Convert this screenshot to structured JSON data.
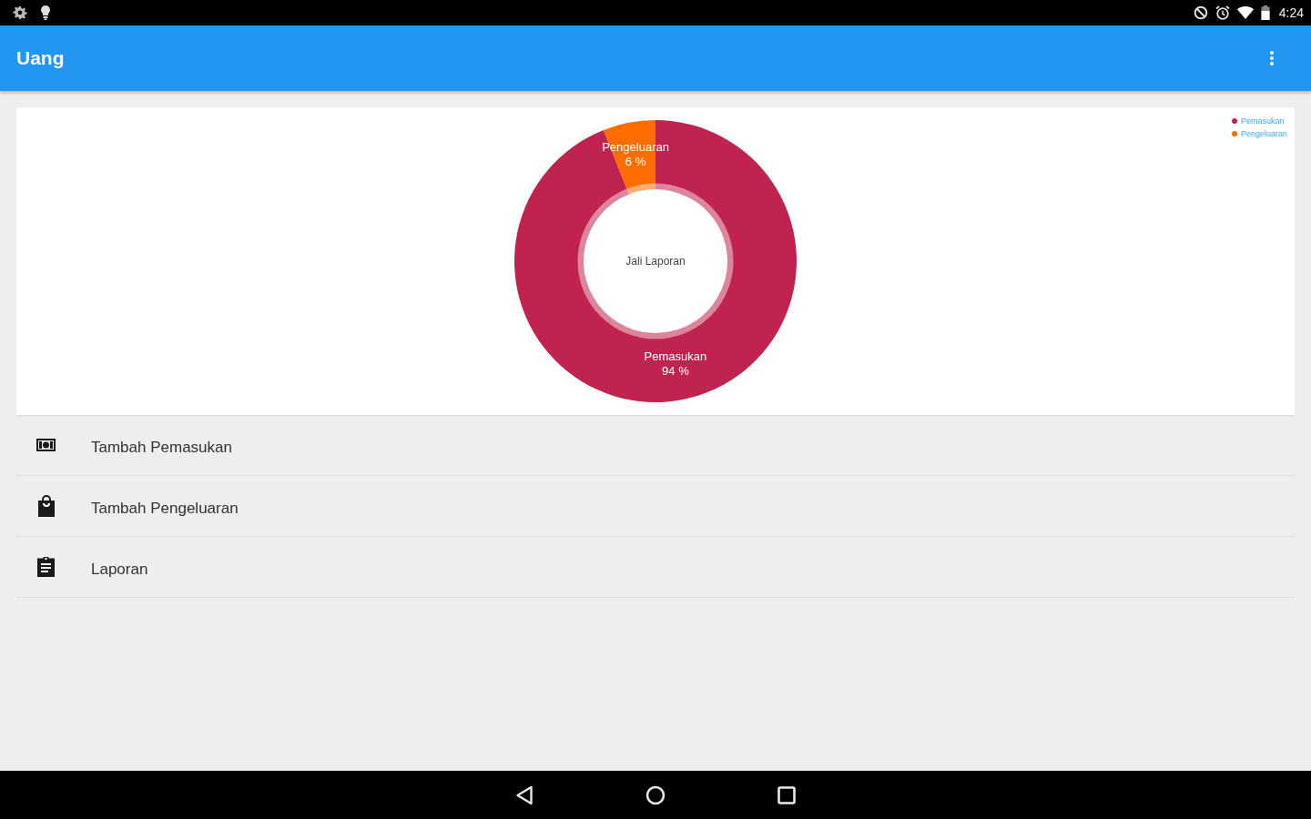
{
  "status_bar": {
    "time": "4:24"
  },
  "app_bar": {
    "title": "Uang"
  },
  "chart_card": {
    "chart_data": [
      {
        "type": "donut",
        "categories": [
          "Pemasukan",
          "Pengeluaran"
        ],
        "values": [
          94,
          6
        ],
        "colors": [
          "#c0234f",
          "#ff6d00"
        ],
        "value_labels": [
          "94 %",
          "6 %"
        ],
        "legend": "top-right",
        "annotations": [
          "Jali Laporan"
        ]
      }
    ]
  },
  "menu": [
    {
      "label": "Tambah Pemasukan"
    },
    {
      "label": "Tambah Pengeluaran"
    },
    {
      "label": "Laporan"
    }
  ]
}
